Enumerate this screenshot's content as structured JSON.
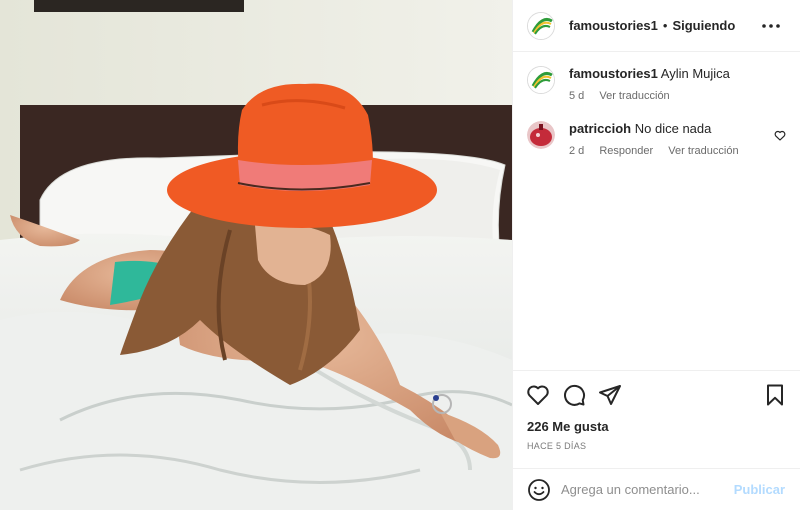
{
  "post": {
    "author": "famoustories1",
    "separator": "•",
    "follow_status": "Siguiendo",
    "more_icon": "more-dots-icon"
  },
  "caption": {
    "username": "famoustories1",
    "text": "Aylin Mujica",
    "age": "5 d",
    "translate": "Ver traducción"
  },
  "comments": [
    {
      "username": "patriccioh",
      "text": "No dice nada",
      "age": "2 d",
      "reply": "Responder",
      "translate": "Ver traducción"
    }
  ],
  "actions": {
    "likes": "226 Me gusta",
    "time": "HACE 5 DÍAS"
  },
  "add_comment": {
    "placeholder": "Agrega un comentario...",
    "post_label": "Publicar"
  },
  "colors": {
    "hat": "#f05a24",
    "hat_band": "#f07b78",
    "post_button_disabled": "#b3dbff",
    "avatar_ring": "#2e9c3a"
  }
}
